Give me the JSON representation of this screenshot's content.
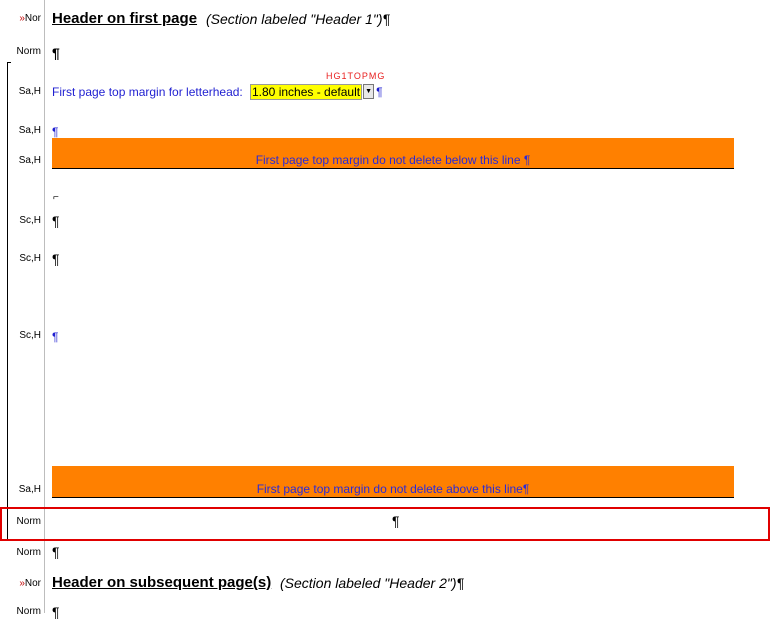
{
  "styles": {
    "row1": "Nor",
    "row1_mark": "»",
    "row2": "Norm",
    "row3": "Sa,H",
    "row4": "Sa,H",
    "row5": "Sa,H",
    "row6": "Sc,H",
    "row7": "Sc,H",
    "row8": "Sc,H",
    "row9": "Sa,H",
    "row10": "Norm",
    "row11": "Norm",
    "row12": "Nor",
    "row12_mark": "»",
    "row13": "Norm"
  },
  "header1": {
    "title": "Header on first page",
    "note": "(Section labeled \"Header 1\")¶"
  },
  "pilcrow": "¶",
  "tiny_mark": "⌐",
  "field_code": "HG1TOPMG",
  "top_margin": {
    "label": "First page top margin for letterhead:",
    "value": "1.80 inches - default",
    "arrow": "▼",
    "end": "¶"
  },
  "orange_top": "First page top margin do not delete below this line ¶",
  "orange_bottom": "First page top margin do not delete above this line¶",
  "header2": {
    "title": "Header on subsequent page(s)",
    "note": "(Section labeled \"Header 2\")¶"
  },
  "colors": {
    "accent_orange": "#ff8000",
    "field_highlight": "#ffff00",
    "selection_box": "#e00000",
    "text_blue": "#1f1fd1"
  }
}
